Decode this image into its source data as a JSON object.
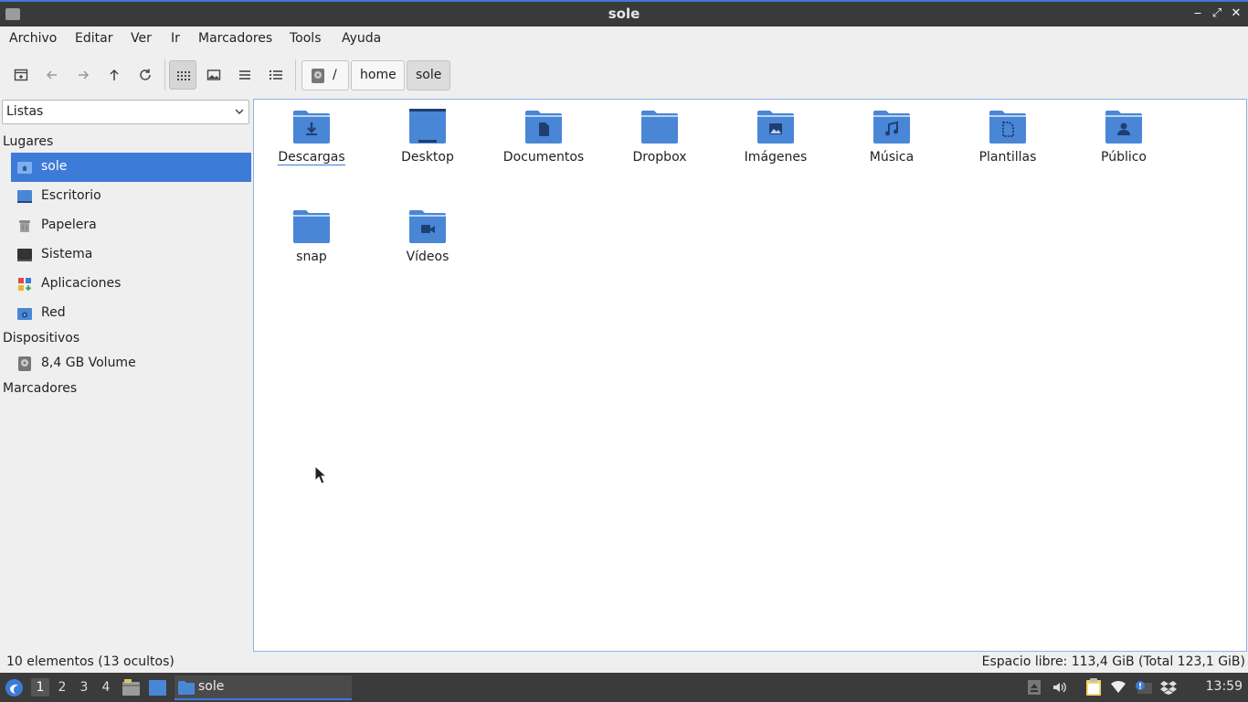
{
  "window": {
    "title": "sole",
    "minimize": "‒",
    "maximize": "⤢",
    "close": "✕"
  },
  "menu": [
    "Archivo",
    "Editar",
    "Ver",
    "Ir",
    "Marcadores",
    "Tools",
    "Ayuda"
  ],
  "breadcrumb": {
    "root": "/",
    "items": [
      "home",
      "sole"
    ]
  },
  "sidebar": {
    "mode": "Listas",
    "sections": {
      "places": "Lugares",
      "devices": "Dispositivos",
      "bookmarks": "Marcadores"
    },
    "places": [
      "sole",
      "Escritorio",
      "Papelera",
      "Sistema",
      "Aplicaciones",
      "Red"
    ],
    "devices": [
      "8,4 GB Volume"
    ]
  },
  "files": [
    "Descargas",
    "Desktop",
    "Documentos",
    "Dropbox",
    "Imágenes",
    "Música",
    "Plantillas",
    "Público",
    "snap",
    "Vídeos"
  ],
  "status": {
    "left": "10 elementos (13 ocultos)",
    "right": "Espacio libre: 113,4 GiB (Total 123,1 GiB)"
  },
  "taskbar": {
    "workspaces": [
      "1",
      "2",
      "3",
      "4"
    ],
    "active_task": "sole",
    "clock": "13:59"
  },
  "colors": {
    "accent": "#3d7bd8",
    "folder": "#4a86d6",
    "folder_dark": "#2a5aa0"
  }
}
